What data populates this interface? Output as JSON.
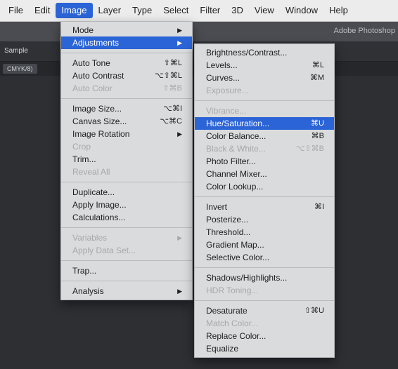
{
  "menubar": {
    "items": [
      {
        "label": "File"
      },
      {
        "label": "Edit"
      },
      {
        "label": "Image"
      },
      {
        "label": "Layer"
      },
      {
        "label": "Type"
      },
      {
        "label": "Select"
      },
      {
        "label": "Filter"
      },
      {
        "label": "3D"
      },
      {
        "label": "View"
      },
      {
        "label": "Window"
      },
      {
        "label": "Help"
      }
    ],
    "active_index": 2
  },
  "app": {
    "title": "Adobe Photoshop"
  },
  "options_bar": {
    "label": "Sample"
  },
  "document_tab": {
    "label": "CMYK/8)"
  },
  "image_menu": {
    "items": [
      {
        "label": "Mode",
        "shortcut": "",
        "submenu": true,
        "disabled": false
      },
      {
        "label": "Adjustments",
        "shortcut": "",
        "submenu": true,
        "disabled": false,
        "highlight": true
      },
      {
        "label": "Auto Tone",
        "shortcut": "⇧⌘L",
        "disabled": false
      },
      {
        "label": "Auto Contrast",
        "shortcut": "⌥⇧⌘L",
        "disabled": false
      },
      {
        "label": "Auto Color",
        "shortcut": "⇧⌘B",
        "disabled": true
      },
      {
        "label": "Image Size...",
        "shortcut": "⌥⌘I",
        "disabled": false
      },
      {
        "label": "Canvas Size...",
        "shortcut": "⌥⌘C",
        "disabled": false
      },
      {
        "label": "Image Rotation",
        "shortcut": "",
        "submenu": true,
        "disabled": false
      },
      {
        "label": "Crop",
        "shortcut": "",
        "disabled": true
      },
      {
        "label": "Trim...",
        "shortcut": "",
        "disabled": false
      },
      {
        "label": "Reveal All",
        "shortcut": "",
        "disabled": true
      },
      {
        "label": "Duplicate...",
        "shortcut": "",
        "disabled": false
      },
      {
        "label": "Apply Image...",
        "shortcut": "",
        "disabled": false
      },
      {
        "label": "Calculations...",
        "shortcut": "",
        "disabled": false
      },
      {
        "label": "Variables",
        "shortcut": "",
        "submenu": true,
        "disabled": true
      },
      {
        "label": "Apply Data Set...",
        "shortcut": "",
        "disabled": true
      },
      {
        "label": "Trap...",
        "shortcut": "",
        "disabled": false
      },
      {
        "label": "Analysis",
        "shortcut": "",
        "submenu": true,
        "disabled": false
      }
    ]
  },
  "adjustments_menu": {
    "items": [
      {
        "label": "Brightness/Contrast...",
        "shortcut": "",
        "disabled": false
      },
      {
        "label": "Levels...",
        "shortcut": "⌘L",
        "disabled": false
      },
      {
        "label": "Curves...",
        "shortcut": "⌘M",
        "disabled": false
      },
      {
        "label": "Exposure...",
        "shortcut": "",
        "disabled": true
      },
      {
        "label": "Vibrance...",
        "shortcut": "",
        "disabled": true
      },
      {
        "label": "Hue/Saturation...",
        "shortcut": "⌘U",
        "disabled": false,
        "highlight": true
      },
      {
        "label": "Color Balance...",
        "shortcut": "⌘B",
        "disabled": false
      },
      {
        "label": "Black & White...",
        "shortcut": "⌥⇧⌘B",
        "disabled": true
      },
      {
        "label": "Photo Filter...",
        "shortcut": "",
        "disabled": false
      },
      {
        "label": "Channel Mixer...",
        "shortcut": "",
        "disabled": false
      },
      {
        "label": "Color Lookup...",
        "shortcut": "",
        "disabled": false
      },
      {
        "label": "Invert",
        "shortcut": "⌘I",
        "disabled": false
      },
      {
        "label": "Posterize...",
        "shortcut": "",
        "disabled": false
      },
      {
        "label": "Threshold...",
        "shortcut": "",
        "disabled": false
      },
      {
        "label": "Gradient Map...",
        "shortcut": "",
        "disabled": false
      },
      {
        "label": "Selective Color...",
        "shortcut": "",
        "disabled": false
      },
      {
        "label": "Shadows/Highlights...",
        "shortcut": "",
        "disabled": false
      },
      {
        "label": "HDR Toning...",
        "shortcut": "",
        "disabled": true
      },
      {
        "label": "Desaturate",
        "shortcut": "⇧⌘U",
        "disabled": false
      },
      {
        "label": "Match Color...",
        "shortcut": "",
        "disabled": true
      },
      {
        "label": "Replace Color...",
        "shortcut": "",
        "disabled": false
      },
      {
        "label": "Equalize",
        "shortcut": "",
        "disabled": false
      }
    ]
  },
  "colors": {
    "accent": "#2b64d6",
    "menu_bg": "#dadbdd",
    "menubar_bg": "#ececec",
    "workspace_bg": "#2d2f33"
  }
}
